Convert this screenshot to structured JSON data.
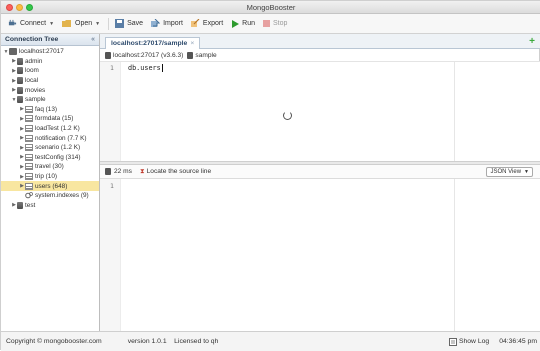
{
  "window": {
    "title": "MongoBooster"
  },
  "toolbar": {
    "connect": "Connect",
    "open": "Open",
    "save": "Save",
    "import": "Import",
    "export": "Export",
    "run": "Run",
    "stop": "Stop"
  },
  "left_panel": {
    "title": "Connection Tree",
    "collapse_glyph": "«",
    "tree": {
      "server": "localhost:27017",
      "databases_top": [
        "admin",
        "loom",
        "local",
        "movies"
      ],
      "sample_db": "sample",
      "collections": [
        "faq (13)",
        "formdata (15)",
        "loadTest (1.2 K)",
        "notification (7.7 K)",
        "scenario (1.2 K)",
        "testConfig (314)",
        "travel (30)",
        "trip (10)",
        "users (648)",
        "system.indexes (9)"
      ],
      "databases_bottom": [
        "test"
      ]
    }
  },
  "editor": {
    "tab_label": "localhost:27017/sample",
    "tab_close": "×",
    "add_tab": "+",
    "crumb_connection": "localhost:27017 (v3.6.3)",
    "crumb_db": "sample",
    "line_numbers_top": [
      "1"
    ],
    "code_line_1": "db.users",
    "result_time": "22 ms",
    "locate_source": "Locate the source line",
    "view_mode": "JSON View",
    "line_numbers_bottom": [
      "1"
    ]
  },
  "status": {
    "copyright": "Copyright © mongobooster.com",
    "version": "version 1.0.1    Licensed to qh",
    "show_log": "Show Log",
    "time": "04:36:45 pm"
  },
  "colors": {
    "selected_row": "#f8e6a0",
    "run_green": "#2e9b2e",
    "tab_text": "#2f4c6e"
  }
}
